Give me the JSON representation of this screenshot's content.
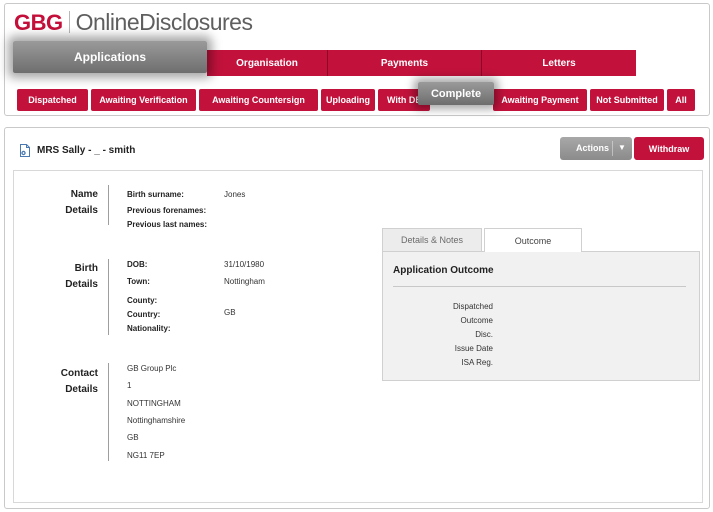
{
  "brand": {
    "logo": "GBG",
    "product": "OnlineDisclosures",
    "accent": "#c2123c"
  },
  "main_nav": {
    "active": "Applications",
    "tabs": [
      "Organisation",
      "Payments",
      "Letters"
    ]
  },
  "status_tabs": {
    "active": "Complete",
    "tabs": [
      "Dispatched",
      "Awaiting Verification",
      "Awaiting Countersign",
      "Uploading",
      "With DBS",
      "Awaiting Payment",
      "Not Submitted",
      "All"
    ]
  },
  "application": {
    "title": "MRS Sally - _ - smith",
    "actions_label": "Actions",
    "withdraw_label": "Withdraw"
  },
  "name_details": {
    "title_line1": "Name",
    "title_line2": "Details",
    "fields": [
      {
        "label": "Birth surname:",
        "value": "Jones"
      },
      {
        "label": "Previous forenames:",
        "value": ""
      },
      {
        "label": "Previous last names:",
        "value": ""
      }
    ]
  },
  "birth_details": {
    "title_line1": "Birth",
    "title_line2": "Details",
    "fields": [
      {
        "label": "DOB:",
        "value": "31/10/1980"
      },
      {
        "label": "Town:",
        "value": "Nottingham"
      },
      {
        "label": "County:",
        "value": ""
      },
      {
        "label": "Country:",
        "value": "GB"
      },
      {
        "label": "Nationality:",
        "value": ""
      }
    ]
  },
  "contact_details": {
    "title_line1": "Contact",
    "title_line2": "Details",
    "lines": [
      "GB Group Plc",
      "1",
      "NOTTINGHAM",
      "Nottinghamshire",
      "GB",
      "NG11 7EP"
    ]
  },
  "tabs": {
    "notes_label": "Details & Notes",
    "outcome_label": "Outcome"
  },
  "outcome": {
    "title": "Application Outcome",
    "labels": [
      "Dispatched",
      "Outcome",
      "Disc.",
      "Issue Date",
      "ISA Reg."
    ]
  }
}
